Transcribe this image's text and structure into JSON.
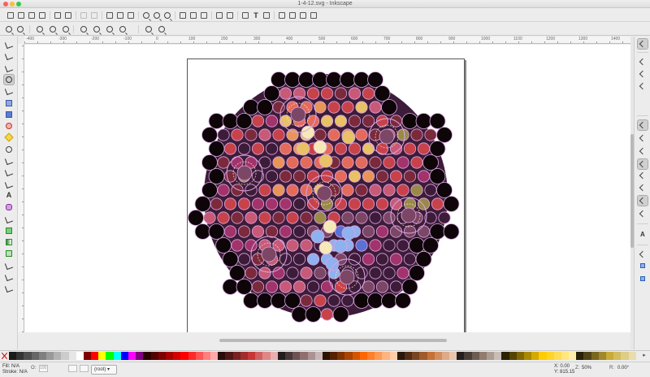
{
  "window": {
    "title": "1-4-12.svg - Inkscape"
  },
  "commands_bar": {
    "icons": [
      "new-document-icon",
      "open-icon",
      "save-icon",
      "print-icon",
      "import-icon",
      "export-icon",
      "undo-icon",
      "redo-icon",
      "copy-icon",
      "cut-icon",
      "paste-icon",
      "zoom-selection-icon",
      "zoom-drawing-icon",
      "zoom-page-icon",
      "duplicate-icon",
      "clone-icon",
      "unlink-clone-icon",
      "group-icon",
      "ungroup-icon",
      "fill-stroke-icon",
      "text-font-icon",
      "layers-icon",
      "xml-editor-icon",
      "align-distribute-icon",
      "preferences-icon",
      "document-properties-icon"
    ]
  },
  "controls_bar": {
    "icons": [
      "zoom-in-icon",
      "zoom-out-icon",
      "zoom-1-1-icon",
      "zoom-1-2-icon",
      "zoom-2-1-icon",
      "zoom-selection-icon",
      "zoom-drawing-icon",
      "zoom-page-icon",
      "zoom-page-width-icon",
      "zoom-previous-icon",
      "zoom-next-icon"
    ]
  },
  "toolbox": {
    "tools": [
      "selector-tool",
      "node-tool",
      "tweak-tool",
      "zoom-tool",
      "measure-tool",
      "rectangle-tool",
      "3d-box-tool",
      "ellipse-tool",
      "star-tool",
      "spiral-tool",
      "pencil-tool",
      "pen-tool",
      "calligraphy-tool",
      "text-tool",
      "spray-tool",
      "eraser-tool",
      "paint-bucket-tool",
      "gradient-tool",
      "mesh-tool",
      "dropper-tool",
      "connector-tool",
      "lpe-tool"
    ],
    "active": "zoom-tool"
  },
  "ruler": {
    "ticks": [
      "-400",
      "-300",
      "-200",
      "-100",
      "0",
      "100",
      "200",
      "300",
      "400",
      "500",
      "600",
      "700",
      "800",
      "900",
      "1000",
      "1100",
      "1200",
      "1300",
      "1400"
    ]
  },
  "palette": {
    "colors": [
      "#1a1a1a",
      "#333333",
      "#4d4d4d",
      "#666666",
      "#808080",
      "#999999",
      "#b3b3b3",
      "#cccccc",
      "#e6e6e6",
      "#ffffff",
      "#800000",
      "#ff0000",
      "#ffff00",
      "#00ff00",
      "#00ffff",
      "#0000ff",
      "#ff00ff",
      "#800080",
      "#2b0000",
      "#550000",
      "#800000",
      "#aa0000",
      "#d40000",
      "#ff0000",
      "#ff2a2a",
      "#ff5555",
      "#ff8080",
      "#ffaaaa",
      "#280b0b",
      "#501616",
      "#782121",
      "#a02c2c",
      "#c83737",
      "#d35f5f",
      "#de8787",
      "#e9afaf",
      "#241c1c",
      "#483737",
      "#6c5353",
      "#916f6f",
      "#ac9393",
      "#c8b7b7",
      "#2b1100",
      "#552200",
      "#803300",
      "#aa4400",
      "#d45500",
      "#ff6600",
      "#ff7f2a",
      "#ff9955",
      "#ffb380",
      "#ffccaa",
      "#28170b",
      "#502d16",
      "#784421",
      "#a05a2c",
      "#c87137",
      "#d38d5f",
      "#deaa87",
      "#e9c6af",
      "#241f1c",
      "#483e37",
      "#6c5d53",
      "#917c6f",
      "#ac9d93",
      "#c8beb7",
      "#2b2200",
      "#554400",
      "#806600",
      "#aa8800",
      "#d4aa00",
      "#ffcc00",
      "#ffd42a",
      "#ffdd55",
      "#ffe680",
      "#ffeeaa",
      "#28220b",
      "#504416",
      "#786721",
      "#a0892c",
      "#c8ab37",
      "#d3bc5f",
      "#decd87",
      "#e9ddaf"
    ]
  },
  "status": {
    "fill_label": "Fill:",
    "fill_value": "N/A",
    "stroke_label": "Stroke:",
    "stroke_value": "N/A",
    "opacity_label": "O:",
    "opacity_value": "100",
    "layer": "(root)",
    "x_label": "X:",
    "x_value": "0.00",
    "y_label": "Y:",
    "y_value": "815.15",
    "z_label": "Z:",
    "zoom_value": "50%",
    "r_label": "R:",
    "rotation_value": "0.00°"
  },
  "drawing": {
    "colors": {
      "black": "#0d0508",
      "outline": "#d9a6e0",
      "deep_purple": "#3d1c3a",
      "maroon": "#7a2a3a",
      "red": "#c8424a",
      "coral": "#e46b5a",
      "orange": "#e8955a",
      "gold": "#e9c167",
      "cream": "#f6e9b8",
      "blue": "#5b71d6",
      "light_blue": "#8eb1f0",
      "magenta": "#a3336b",
      "rose": "#c85a78",
      "olive": "#9a8a4a",
      "mauve": "#7b4765"
    }
  }
}
